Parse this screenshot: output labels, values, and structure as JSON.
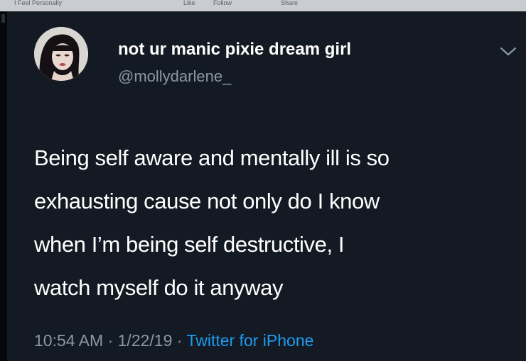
{
  "browser_strip": {
    "left_text": "I Feel Personally",
    "actions": [
      "Like",
      "Follow",
      "Share"
    ]
  },
  "tweet": {
    "display_name": "not ur manic pixie dream girl",
    "handle": "@mollydarlene_",
    "text_lines": [
      "Being self aware and mentally ill is so",
      "exhausting cause not only do I know",
      "when I’m being self destructive, I",
      "watch myself do it anyway"
    ],
    "time": "10:54 AM",
    "separator": "·",
    "date": "1/22/19",
    "source": "Twitter for iPhone"
  },
  "icons": {
    "menu": "chevron-down-icon",
    "avatar": "profile-photo"
  },
  "colors": {
    "background": "#141a23",
    "text": "#ffffff",
    "secondary": "#8a98a6",
    "link": "#1d9bf0"
  }
}
